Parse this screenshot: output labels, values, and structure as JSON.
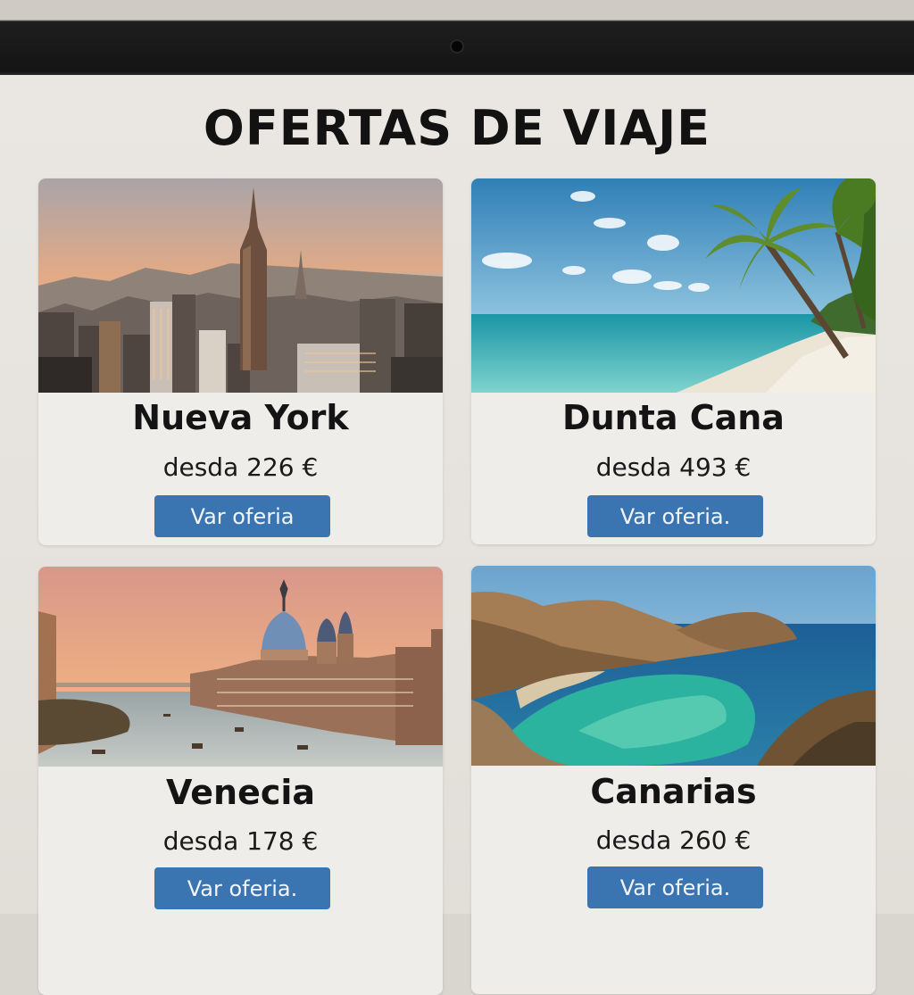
{
  "page": {
    "title": "OFERTAS DE VIAJE"
  },
  "offers": [
    {
      "name": "Nueva York",
      "price": "desda 226 €",
      "button": "Var oferia",
      "image": "new-york-skyline"
    },
    {
      "name": "Dunta Cana",
      "price": "desda 493 €",
      "button": "Var oferia.",
      "image": "caribbean-beach-palm"
    },
    {
      "name": "Venecia",
      "price": "desda 178 €",
      "button": "Var oferia.",
      "image": "venice-grand-canal"
    },
    {
      "name": "Canarias",
      "price": "desda 260 €",
      "button": "Var oferia.",
      "image": "canary-islands-cove"
    }
  ],
  "colors": {
    "button": "#3a74b1",
    "card": "#efedea",
    "screen": "#e8e5e1",
    "bezel": "#161616"
  }
}
